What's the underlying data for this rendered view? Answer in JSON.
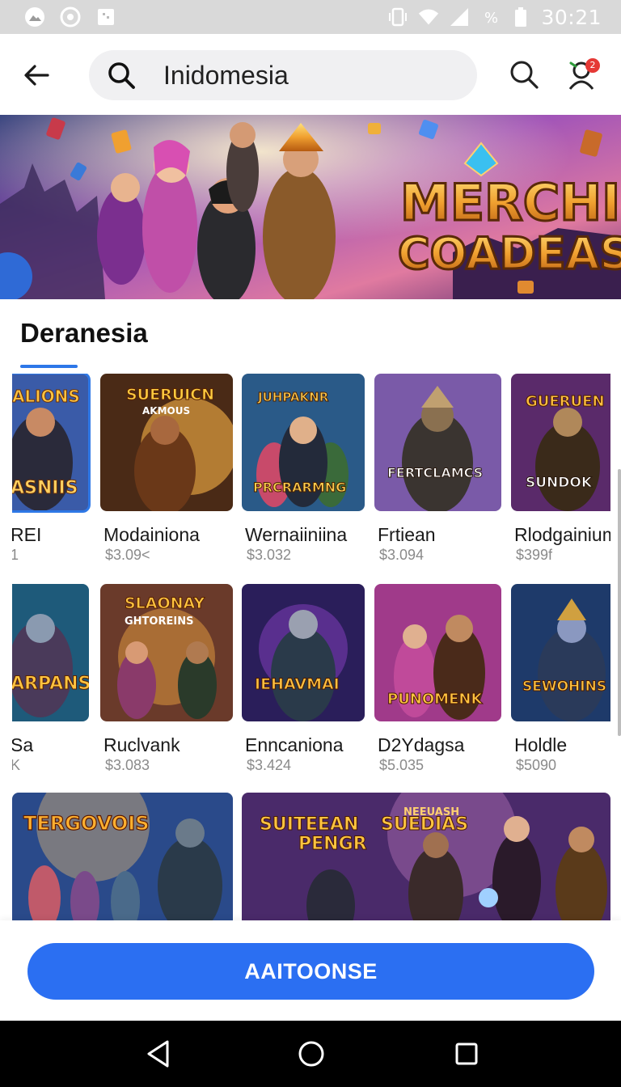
{
  "status_bar": {
    "time": "30:21",
    "left_icons": [
      "gallery-icon",
      "sync-icon",
      "screenshot-icon"
    ],
    "right_icons": [
      "vibrate-icon",
      "wifi-icon",
      "signal-icon",
      "data-saver-icon",
      "battery-icon"
    ]
  },
  "app_bar": {
    "search_value": "Inidomesia",
    "notification_count": "2"
  },
  "banner": {
    "title_line1": "MERCHI",
    "title_line2": "COADEASI"
  },
  "section": {
    "title": "Deranesia"
  },
  "row1": [
    {
      "name": "REI",
      "price": "1",
      "art": "ALIONS · ASNIIS · A GLO GUIS"
    },
    {
      "name": "Modainiona",
      "price": "$3.09<",
      "art": "SUERUICN · AKMOUS"
    },
    {
      "name": "Wernaiiniina",
      "price": "$3.032",
      "art": "JUHPAKNR · PRCRARMNG"
    },
    {
      "name": "Frtiean",
      "price": "$3.094",
      "art": "FERTCLAMCS"
    },
    {
      "name": "Rlodgainium",
      "price": "$399f",
      "art": "GUERUEN · SUNDOK"
    }
  ],
  "row2": [
    {
      "name": "Sa",
      "price": "K",
      "art": "ARPANS"
    },
    {
      "name": "Ruclvank",
      "price": "$3.083",
      "art": "SLAONAY · GHTOREINS"
    },
    {
      "name": "Enncaniona",
      "price": "$3.424",
      "art": "IEHAVMAI"
    },
    {
      "name": "D2Ydagsa",
      "price": "$5.035",
      "art": "PUNOMENK"
    },
    {
      "name": "Holdle",
      "price": "$5090",
      "art": "SEWOHINS"
    }
  ],
  "row3": [
    {
      "art": "TERGOVOIS"
    },
    {
      "art": "SUITEEAN PENGR · NEEUASH SUEDIAS"
    }
  ],
  "cta_label": "AAITOONSE",
  "colors": {
    "accent": "#2b6ff2",
    "underline": "#2d77e8",
    "price": "#8a8a8a",
    "status_bar": "#d9d9d9"
  }
}
